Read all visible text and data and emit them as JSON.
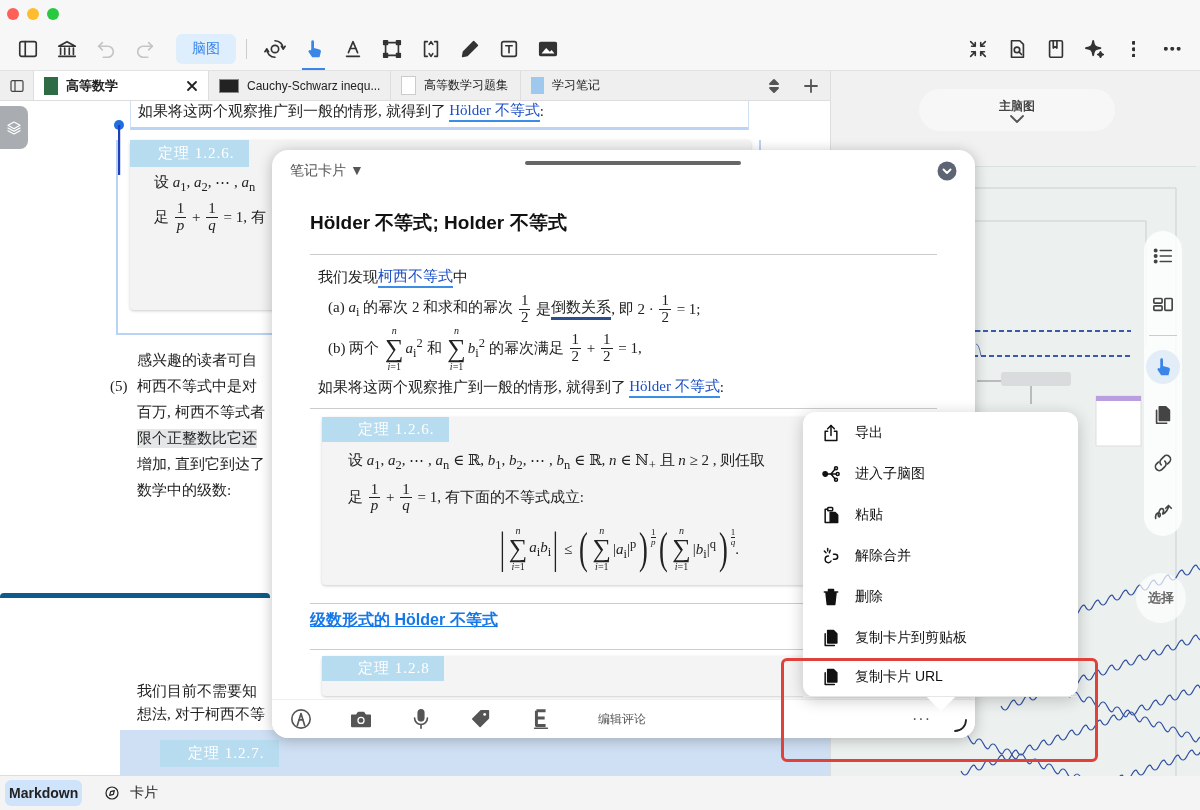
{
  "toolbar": {
    "left": [
      {
        "kind": "sidebar",
        "disabled": false
      },
      {
        "kind": "library",
        "disabled": false
      },
      {
        "kind": "undo",
        "disabled": true
      },
      {
        "kind": "redo",
        "disabled": true
      }
    ],
    "mode_button": {
      "label": "脑图",
      "selected": true
    },
    "tools": [
      {
        "kind": "gear",
        "selected": false
      },
      {
        "kind": "hand",
        "selected": true
      },
      {
        "kind": "text",
        "selected": false
      },
      {
        "kind": "select",
        "selected": false
      },
      {
        "kind": "resize",
        "selected": false
      },
      {
        "kind": "pencil",
        "selected": false
      },
      {
        "kind": "textbox",
        "selected": false
      },
      {
        "kind": "image",
        "selected": false
      }
    ],
    "right": [
      {
        "kind": "collapse"
      },
      {
        "kind": "doc-search"
      },
      {
        "kind": "bookmark"
      },
      {
        "kind": "sparkle"
      },
      {
        "kind": "vdots"
      },
      {
        "kind": "hdots"
      }
    ]
  },
  "tabs": [
    {
      "label": "高等数学",
      "selected": true,
      "kind": "book"
    },
    {
      "label": "Cauchy-Schwarz inequ...",
      "selected": false,
      "kind": "terminal"
    },
    {
      "label": "高等数学习题集",
      "selected": false,
      "kind": "doc"
    },
    {
      "label": "学习笔记",
      "selected": false,
      "kind": "notebook"
    }
  ],
  "document": {
    "top_line": [
      {
        "kind": "text",
        "text": "如果将这两个观察推广到一般的情形, 就得到了 "
      },
      {
        "kind": "link",
        "text": "Hölder 不等式"
      },
      {
        "kind": "text",
        "text": ":"
      }
    ],
    "theorem": {
      "label": "定理 1.2.6.",
      "lines": [
        [
          {
            "kind": "text",
            "text": "设 *a*$_{1}$, *a*$_{2}$, ⋯ , *a*$_{n}$"
          }
        ],
        [
          {
            "kind": "text",
            "text": "足 "
          },
          {
            "kind": "frac",
            "num": "1",
            "den": "*p*"
          },
          {
            "kind": "text",
            "text": " + "
          },
          {
            "kind": "frac",
            "num": "1",
            "den": "*q*"
          },
          {
            "kind": "text",
            "text": " = 1, 有"
          }
        ]
      ]
    },
    "paragraph": [
      {
        "text": "感兴趣的读者可自",
        "shaded": false
      },
      {
        "marker": "(5)",
        "text": "柯西不等式中是对",
        "shaded": false
      },
      {
        "text": "百万, 柯西不等式者",
        "shaded": false
      },
      {
        "text": "限个正整数比它还",
        "shaded": true
      },
      {
        "text": "增加, 直到它到达了",
        "shaded": false
      },
      {
        "text": "数学中的级数:",
        "shaded": false
      }
    ],
    "lower": [
      "我们目前不需要知",
      "想法, 对于柯西不等"
    ],
    "next_theorem": "定理 1.2.7."
  },
  "card": {
    "kind_label": "笔记卡片 ▼",
    "title": "Hölder 不等式; Holder 不等式",
    "lines": [
      [
        {
          "kind": "text",
          "text": "我们发现"
        },
        {
          "kind": "link",
          "text": "柯西不等式"
        },
        {
          "kind": "text",
          "text": "中"
        }
      ],
      [
        {
          "kind": "text",
          "text": "(a) *a*$_{i}$ 的幂次 2 和求和的幂次 "
        },
        {
          "kind": "frac",
          "num": "1",
          "den": "2"
        },
        {
          "kind": "text",
          "text": " 是"
        },
        {
          "kind": "term",
          "text": "倒数关系"
        },
        {
          "kind": "text",
          "text": ", 即 2 · "
        },
        {
          "kind": "frac",
          "num": "1",
          "den": "2"
        },
        {
          "kind": "text",
          "text": " = 1;"
        }
      ],
      [
        {
          "kind": "text",
          "text": "(b) 两个 "
        },
        {
          "kind": "sum",
          "symbol": "∑",
          "top": "*n*",
          "bottom": "*i*=1"
        },
        {
          "kind": "text",
          "text": "*a*$_{i}$$^{2}$ 和 "
        },
        {
          "kind": "sum",
          "symbol": "∑",
          "top": "*n*",
          "bottom": "*i*=1"
        },
        {
          "kind": "text",
          "text": "*b*$_{i}$$^{2}$ 的幂次满足 "
        },
        {
          "kind": "frac",
          "num": "1",
          "den": "2"
        },
        {
          "kind": "text",
          "text": " + "
        },
        {
          "kind": "frac",
          "num": "1",
          "den": "2"
        },
        {
          "kind": "text",
          "text": " = 1,"
        }
      ],
      [
        {
          "kind": "text",
          "text": "如果将这两个观察推广到一般的情形, 就得到了 "
        },
        {
          "kind": "link",
          "text": "Hölder 不等式"
        },
        {
          "kind": "text",
          "text": ":"
        }
      ]
    ],
    "theorem": {
      "label": "定理 1.2.6.",
      "lines": [
        [
          {
            "kind": "text",
            "text": "设 *a*$_{1}$, *a*$_{2}$, ⋯ , *a*$_{n}$ ∈ ℝ, *b*$_{1}$, *b*$_{2}$, ⋯ , *b*$_{n}$ ∈ ℝ, *n* ∈ ℕ$_{+}$ 且 *n* ≥ 2 , 则任取"
          }
        ],
        [
          {
            "kind": "text",
            "text": "足 "
          },
          {
            "kind": "frac",
            "num": "1",
            "den": "*p*"
          },
          {
            "kind": "text",
            "text": " + "
          },
          {
            "kind": "frac",
            "num": "1",
            "den": "*q*"
          },
          {
            "kind": "text",
            "text": " = 1, 有下面的不等式成立:"
          }
        ]
      ],
      "display": [
        {
          "kind": "big",
          "text": "|"
        },
        {
          "kind": "sum",
          "symbol": "∑",
          "top": "*n*",
          "bottom": "*i*=1"
        },
        {
          "kind": "text",
          "text": "*a*$_{i}$*b*$_{i}$"
        },
        {
          "kind": "big",
          "text": "|"
        },
        {
          "kind": "text",
          "text": " ≤ "
        },
        {
          "kind": "big",
          "text": "("
        },
        {
          "kind": "sum",
          "symbol": "∑",
          "top": "*n*",
          "bottom": "*i*=1"
        },
        {
          "kind": "text",
          "text": "|*a*$_{i}$|$^{p}$"
        },
        {
          "kind": "big",
          "text": ")"
        },
        {
          "kind": "supfrac",
          "num": "1",
          "den": "*p*"
        },
        {
          "kind": "big",
          "text": "("
        },
        {
          "kind": "sum",
          "symbol": "∑",
          "top": "*n*",
          "bottom": "*i*=1"
        },
        {
          "kind": "text",
          "text": "|*b*$_{i}$|$^{q}$"
        },
        {
          "kind": "big",
          "text": ")"
        },
        {
          "kind": "supfrac",
          "num": "1",
          "den": "*q*"
        },
        {
          "kind": "text",
          "text": "."
        }
      ]
    },
    "section_link": "级数形式的 Hölder 不等式",
    "next_theorem": "定理 1.2.8",
    "bottom_tools": [
      {
        "kind": "pen"
      },
      {
        "kind": "camera"
      },
      {
        "kind": "mic"
      },
      {
        "kind": "tag"
      },
      {
        "kind": "excerpt"
      }
    ],
    "comment_label": "编辑评论",
    "more": "···"
  },
  "menu": [
    {
      "label": "导出",
      "kind": "export",
      "highlighted": false
    },
    {
      "label": "进入子脑图",
      "kind": "subtree",
      "highlighted": false
    },
    {
      "label": "粘贴",
      "kind": "paste",
      "highlighted": false
    },
    {
      "label": "解除合并",
      "kind": "unmerge",
      "highlighted": false
    },
    {
      "label": "删除",
      "kind": "delete",
      "highlighted": false
    },
    {
      "label": "复制卡片到剪贴板",
      "kind": "copy",
      "highlighted": false
    },
    {
      "label": "复制卡片 URL",
      "kind": "copy",
      "highlighted": true
    }
  ],
  "mindmap": {
    "title": "主脑图",
    "side_tools": [
      {
        "kind": "list",
        "selected": false
      },
      {
        "kind": "layout",
        "selected": false
      },
      {
        "kind": "hand",
        "selected": true
      },
      {
        "kind": "copy",
        "selected": false
      },
      {
        "kind": "link",
        "selected": false
      },
      {
        "kind": "squiggle",
        "selected": false
      }
    ],
    "select_label": "选择"
  },
  "bottom_bar": [
    {
      "label": "Markdown",
      "kind": "plain",
      "selected": true
    },
    {
      "label": "卡片",
      "kind": "compass",
      "selected": false
    }
  ]
}
